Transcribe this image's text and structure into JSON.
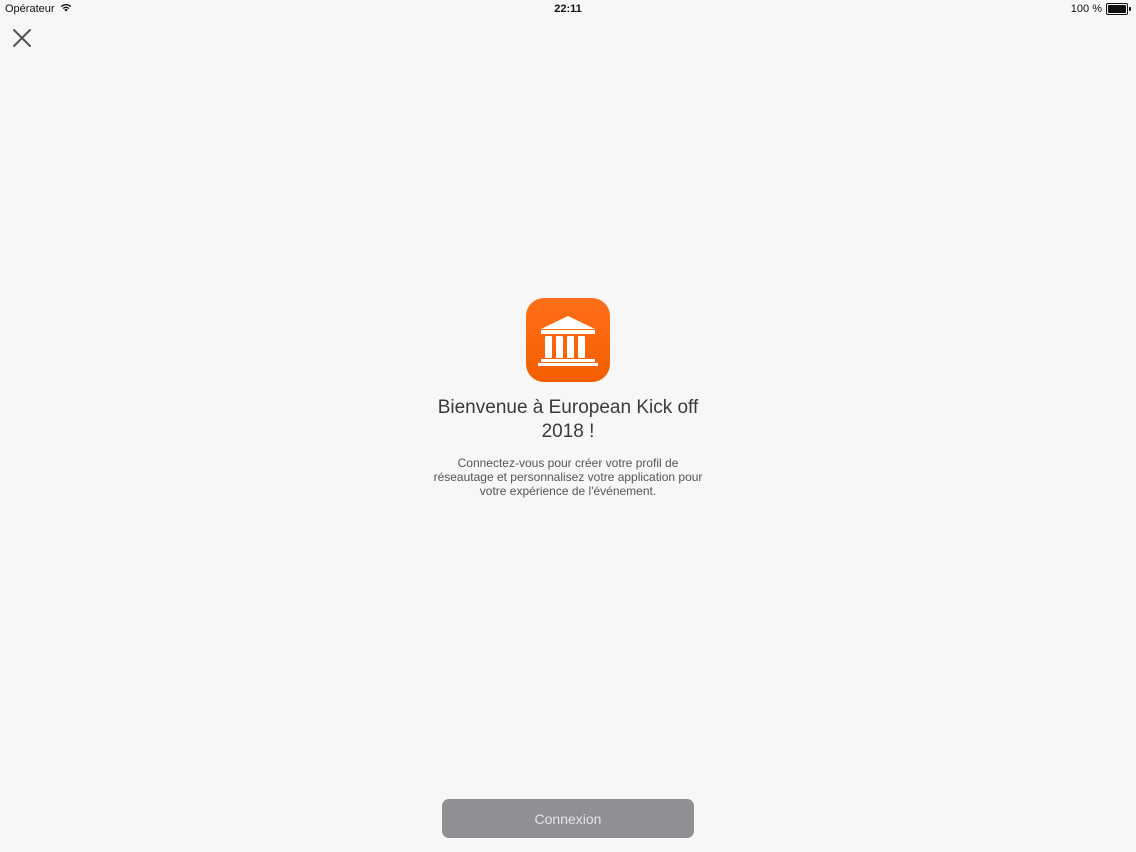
{
  "status_bar": {
    "carrier": "Opérateur",
    "time": "22:11",
    "battery_percent": "100 %",
    "icons": [
      "wifi-icon",
      "battery-icon"
    ]
  },
  "close": {
    "icon": "close-icon"
  },
  "welcome": {
    "app_icon": "pantheon-building-icon",
    "title": "Bienvenue à European Kick off 2018 !",
    "description": "Connectez-vous pour créer votre profil de réseautage et personnalisez votre application pour votre expérience de l'événement."
  },
  "actions": {
    "login_label": "Connexion"
  },
  "colors": {
    "background": "#f7f7f8",
    "app_icon": "#f45e00",
    "button": "#8e9094",
    "button_text": "#e4e5e6"
  }
}
